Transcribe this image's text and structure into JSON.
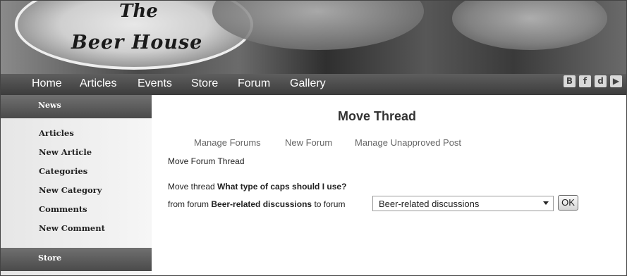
{
  "header": {
    "logo_line1": "The",
    "logo_line2": "Beer House"
  },
  "nav": {
    "items": [
      "Home",
      "Articles",
      "Events",
      "Store",
      "Forum",
      "Gallery"
    ]
  },
  "social": {
    "icons": [
      "blog-icon",
      "facebook-icon",
      "delicious-icon",
      "youtube-icon"
    ],
    "glyphs": [
      "B",
      "f",
      "d",
      "▶"
    ]
  },
  "sidebar": {
    "sections": [
      {
        "heading": "News",
        "items": [
          "Articles",
          "New Article",
          "Categories",
          "New Category",
          "Comments",
          "New Comment"
        ]
      },
      {
        "heading": "Store",
        "items": []
      }
    ]
  },
  "main": {
    "title": "Move Thread",
    "links": [
      "Manage Forums",
      "New Forum",
      "Manage Unapproved Post"
    ],
    "subtitle": "Move Forum Thread",
    "move_label": "Move thread",
    "thread_name": "What type of caps should I use?",
    "from_label": "from forum",
    "from_forum": "Beer-related discussions",
    "to_label": "to forum",
    "to_forum_selected": "Beer-related discussions",
    "ok_label": "OK"
  },
  "colors": {
    "nav_bg": "#4a4a4a",
    "sidebar_header_bg": "#5a5a5a",
    "sidebar_bg": "#eeeeee"
  }
}
